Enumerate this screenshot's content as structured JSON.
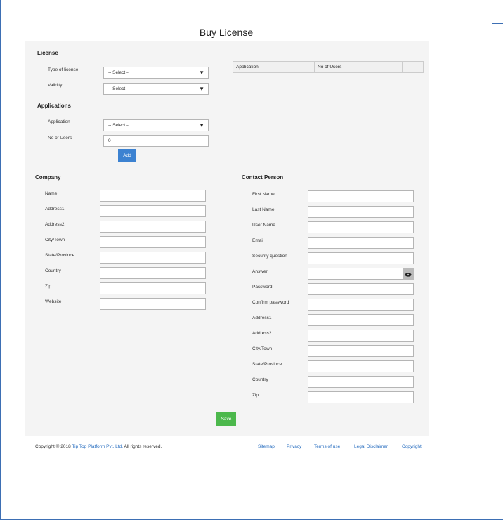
{
  "page_title": "Buy License",
  "license": {
    "heading": "License",
    "type_label": "Type of license",
    "type_value": "-- Select --",
    "validity_label": "Validity",
    "validity_value": "-- Select --"
  },
  "applications": {
    "heading": "Applications",
    "application_label": "Application",
    "application_value": "-- Select --",
    "users_label": "No of Users",
    "users_value": "0",
    "add_label": "Add"
  },
  "app_table": {
    "col_application": "Application",
    "col_users": "No of Users"
  },
  "company": {
    "heading": "Company",
    "fields": [
      "Name",
      "Address1",
      "Address2",
      "City/Town",
      "State/Province",
      "Country",
      "Zip",
      "Website"
    ]
  },
  "contact": {
    "heading": "Contact Person",
    "fields": [
      "First Name",
      "Last Name",
      "User Name",
      "Email",
      "Security question",
      "Answer",
      "Password",
      "Confirm password",
      "Address1",
      "Address2",
      "City/Town",
      "State/Province",
      "Country",
      "Zip"
    ]
  },
  "save_label": "Save",
  "footer": {
    "copyright_prefix": "Copyright © 2018",
    "company_link": "Tip Top Platform Pvt. Ltd.",
    "copyright_suffix": "All rights reserved.",
    "links": [
      "Sitemap",
      "Privacy",
      "Terms of use",
      "Legal Disclaimer",
      "Copyright"
    ]
  },
  "icons": {
    "dropdown": "caret-down-icon",
    "reveal": "eye-icon"
  }
}
